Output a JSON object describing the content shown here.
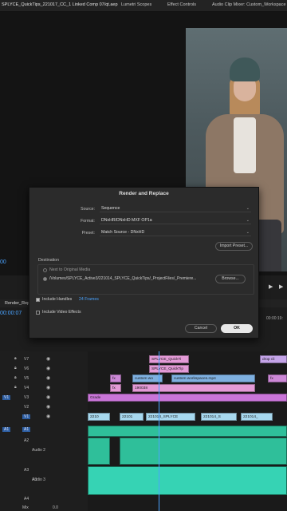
{
  "tabs": [
    "SPLYCE_QuickTips_221017_CC_1 Linked Comp 07/qt.aep",
    "Lumetri Scopes",
    "Effect Controls",
    "Audio Clip Mixer: Custom_Workspace"
  ],
  "monitor": {
    "timecode": "00",
    "timecode2": "00:00:07",
    "sequence_tab": "Render_Rep",
    "timecode_right": "00:00:19:"
  },
  "dialog": {
    "title": "Render and Replace",
    "source_label": "Source:",
    "source_value": "Sequence",
    "format_label": "Format:",
    "format_value": "DNxHR/DNxHD MXF OP1a",
    "preset_label": "Preset:",
    "preset_value": "Match Source - DNxHD",
    "import_preset": "Import Preset...",
    "destination_label": "Destination",
    "next_to_original": "Next to Original Media",
    "path": "/Volumes/SPLYCE_Active3/221014_SPLYCE_QuickTips/_ProjectFiles/_Premiere...",
    "browse": "Browse...",
    "include_handles": "Include Handles",
    "handles_value": "24 Frames",
    "include_video_effects": "Include Video Effects",
    "cancel": "Cancel",
    "ok": "OK"
  },
  "timeline": {
    "tracks": [
      {
        "id": "V7"
      },
      {
        "id": "V6"
      },
      {
        "id": "V5"
      },
      {
        "id": "V4"
      },
      {
        "id": "V3",
        "src": "V1"
      },
      {
        "id": "V2"
      },
      {
        "id": "V1"
      }
    ],
    "audio": [
      {
        "id": "A1",
        "src": "A1",
        "name": ""
      },
      {
        "id": "A2",
        "name": "Audio 2"
      },
      {
        "id": "A3",
        "name": "Audio 3"
      },
      {
        "id": "A4",
        "name": ""
      }
    ],
    "mix_label": "Mix",
    "mix_value": "0.0",
    "clips": {
      "v7a": "SPLYCE_QuickTi",
      "v6a": "SPLYCE_QuickTip",
      "v5a": "fx",
      "v5b": "custom wo",
      "v5c": "custom workspaces.mp4",
      "v4a": "fx",
      "v4b": "190038",
      "grade": "Grade",
      "v1a": "2210",
      "v1b": "22101",
      "v1c": "221014_SPLYCE",
      "v1d": "221014_S",
      "v1e": "221014_",
      "v7b": "drop cli",
      "v5d": "fx"
    }
  }
}
